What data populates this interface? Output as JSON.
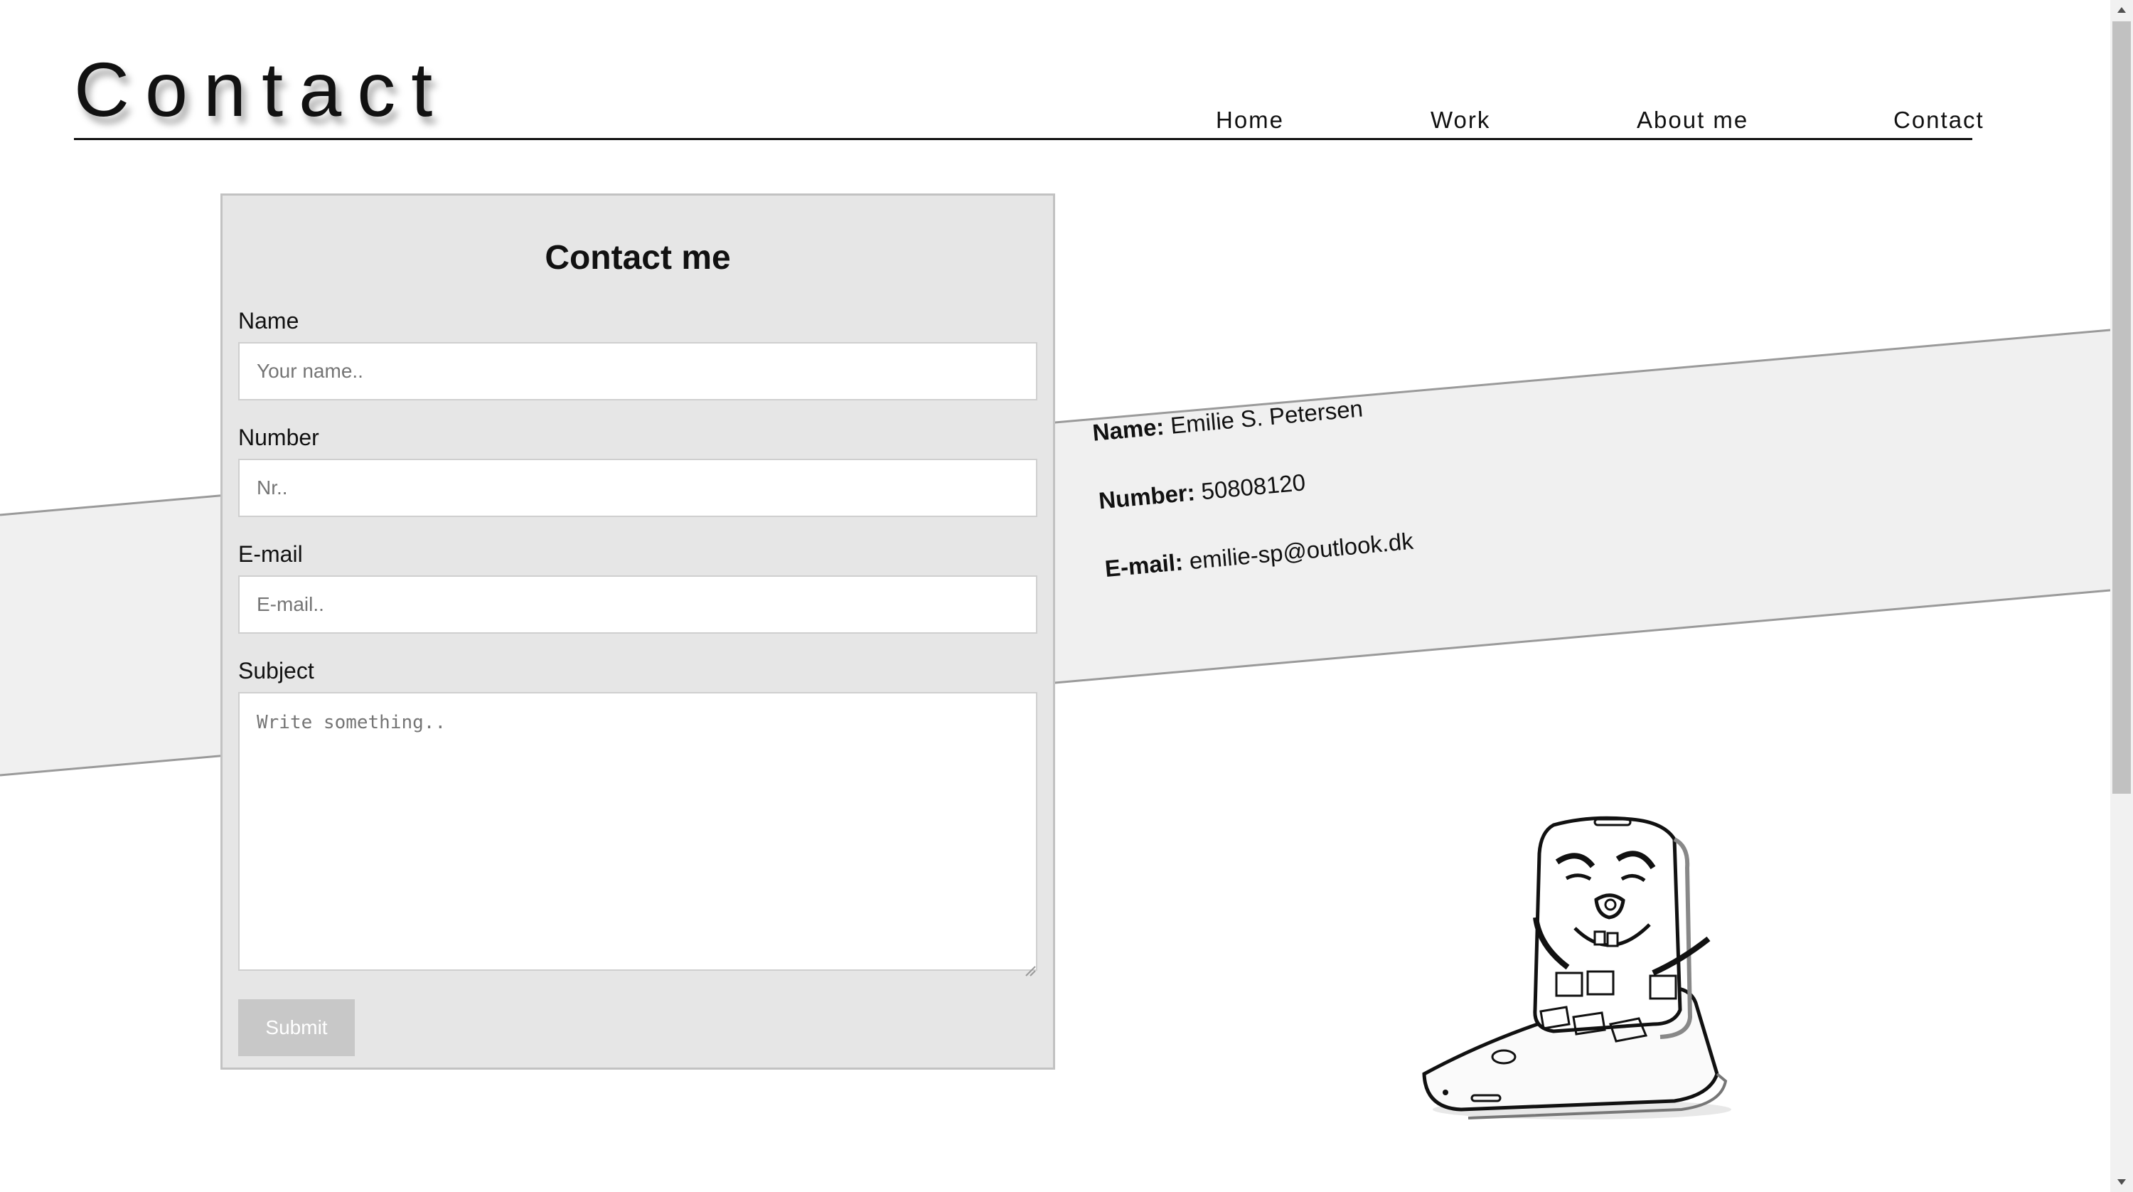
{
  "header": {
    "title": "Contact",
    "nav": [
      {
        "label": "Home"
      },
      {
        "label": "Work"
      },
      {
        "label": "About me"
      },
      {
        "label": "Contact"
      }
    ]
  },
  "form": {
    "title": "Contact me",
    "fields": {
      "name": {
        "label": "Name",
        "placeholder": "Your name..",
        "value": ""
      },
      "number": {
        "label": "Number",
        "placeholder": "Nr..",
        "value": ""
      },
      "email": {
        "label": "E-mail",
        "placeholder": "E-mail..",
        "value": ""
      },
      "subject": {
        "label": "Subject",
        "placeholder": "Write something..",
        "value": ""
      }
    },
    "submit_label": "Submit"
  },
  "info": {
    "name_key": "Name:",
    "name_value": "Emilie S. Petersen",
    "number_key": "Number:",
    "number_value": "50808120",
    "email_key": "E-mail:",
    "email_value": "emilie-sp@outlook.dk"
  },
  "illustration": {
    "icon": "phone-character-sketch-icon"
  },
  "colors": {
    "panel_bg": "#e6e6e6",
    "band_bg": "#f0f0f0",
    "submit_bg": "#c8c8c8"
  }
}
